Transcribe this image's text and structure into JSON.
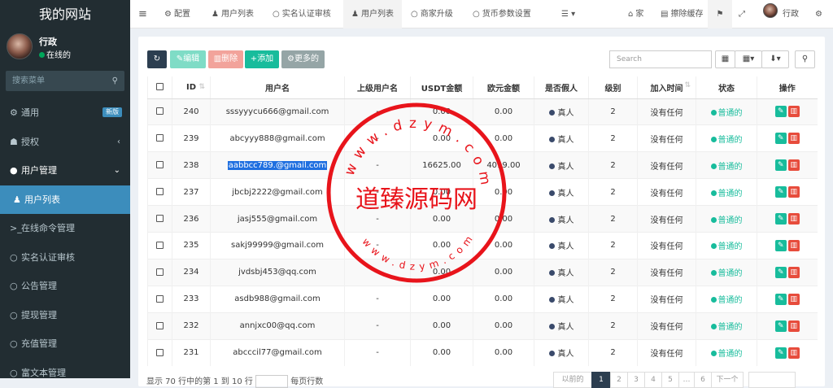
{
  "sidebar": {
    "logo": "我的网站",
    "user": {
      "name": "行政",
      "status": "在线的"
    },
    "search_placeholder": "搜索菜单",
    "menu": [
      {
        "label": "通用",
        "badge": "新版"
      },
      {
        "label": "授权"
      },
      {
        "label": "用户管理"
      },
      {
        "label": "用户列表"
      },
      {
        "label": "在线命令管理"
      },
      {
        "label": "实名认证审核"
      },
      {
        "label": "公告管理"
      },
      {
        "label": "提现管理"
      },
      {
        "label": "充值管理"
      },
      {
        "label": "富文本管理"
      }
    ]
  },
  "topbar": {
    "tabs": [
      "配置",
      "用户列表",
      "实名认证审核",
      "用户列表",
      "商家升级",
      "货币参数设置"
    ],
    "home": "家",
    "clear_cache": "擦除缓存",
    "user": "行政"
  },
  "toolbar": {
    "edit": "编辑",
    "delete": "删除",
    "add": "添加",
    "more": "更多的",
    "search_placeholder": "Search"
  },
  "table": {
    "headers": [
      "ID",
      "用户名",
      "上级用户名",
      "USDT金额",
      "欧元金额",
      "是否假人",
      "级别",
      "加入时间",
      "状态",
      "操作"
    ],
    "rows": [
      {
        "id": "240",
        "username": "sssyyycu666@gmail.com",
        "parent": "-",
        "usdt": "0.00",
        "eur": "0.00",
        "fake": "真人",
        "level": "2",
        "joined": "没有任何",
        "status": "普通的"
      },
      {
        "id": "239",
        "username": "abcyyy888@gmail.com",
        "parent": "-",
        "usdt": "0.00",
        "eur": "0.00",
        "fake": "真人",
        "level": "2",
        "joined": "没有任何",
        "status": "普通的"
      },
      {
        "id": "238",
        "username": "aabbcc789.@gmail.com",
        "parent": "-",
        "usdt": "16625.00",
        "eur": "4019.00",
        "fake": "真人",
        "level": "2",
        "joined": "没有任何",
        "status": "普通的"
      },
      {
        "id": "237",
        "username": "jbcbj2222@gmail.com",
        "parent": "-",
        "usdt": "0.00",
        "eur": "0.00",
        "fake": "真人",
        "level": "2",
        "joined": "没有任何",
        "status": "普通的"
      },
      {
        "id": "236",
        "username": "jasj555@gmail.com",
        "parent": "-",
        "usdt": "0.00",
        "eur": "0.00",
        "fake": "真人",
        "level": "2",
        "joined": "没有任何",
        "status": "普通的"
      },
      {
        "id": "235",
        "username": "sakj99999@gmail.com",
        "parent": "-",
        "usdt": "0.00",
        "eur": "0.00",
        "fake": "真人",
        "level": "2",
        "joined": "没有任何",
        "status": "普通的"
      },
      {
        "id": "234",
        "username": "jvdsbj453@qq.com",
        "parent": "-",
        "usdt": "0.00",
        "eur": "0.00",
        "fake": "真人",
        "level": "2",
        "joined": "没有任何",
        "status": "普通的"
      },
      {
        "id": "233",
        "username": "asdb988@gmail.com",
        "parent": "-",
        "usdt": "0.00",
        "eur": "0.00",
        "fake": "真人",
        "level": "2",
        "joined": "没有任何",
        "status": "普通的"
      },
      {
        "id": "232",
        "username": "annjxc00@qq.com",
        "parent": "-",
        "usdt": "0.00",
        "eur": "0.00",
        "fake": "真人",
        "level": "2",
        "joined": "没有任何",
        "status": "普通的"
      },
      {
        "id": "231",
        "username": "abcccil77@gmail.com",
        "parent": "-",
        "usdt": "0.00",
        "eur": "0.00",
        "fake": "真人",
        "level": "2",
        "joined": "没有任何",
        "status": "普通的"
      }
    ]
  },
  "footer": {
    "summary": "显示 70 行中的第 1 到 10 行",
    "per_page_suffix": "每页行数",
    "prev": "以前的",
    "pages": [
      "1",
      "2",
      "3",
      "4",
      "5",
      "6"
    ],
    "next": "下一个"
  },
  "watermark": {
    "text": "道臻源码网",
    "url_top": "www.dzym.com",
    "url_bottom": "www.dzym.com"
  },
  "colors": {
    "sidebar_bg": "#222d32",
    "active_menu": "#3c8dbc",
    "btn_edit": "#7fdcc6",
    "btn_delete": "#f2a39b",
    "btn_add": "#18bc9c",
    "btn_more": "#95a5a6",
    "btn_refresh": "#2c3e50",
    "op_edit": "#18bc9c",
    "op_delete": "#e74c3c",
    "watermark": "#e8141b"
  }
}
